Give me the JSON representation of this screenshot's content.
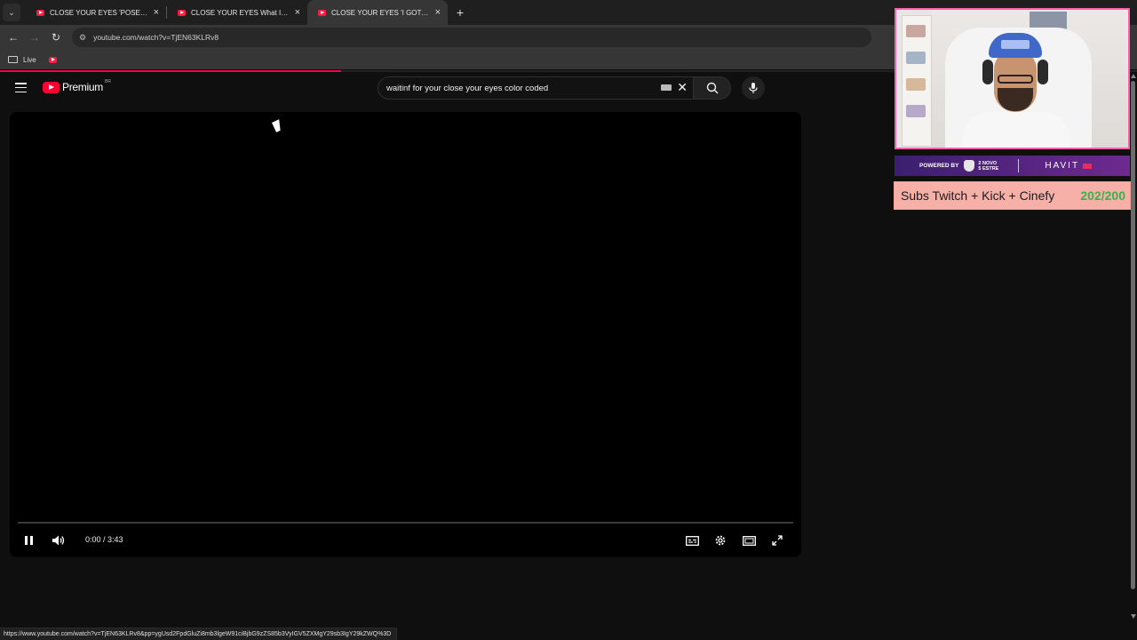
{
  "browser": {
    "tabs": [
      {
        "title": "CLOSE YOUR EYES 'POSE' MV -",
        "active": false
      },
      {
        "title": "CLOSE YOUR EYES What If I Mi",
        "active": false
      },
      {
        "title": "CLOSE YOUR EYES 'I GOT IT' (O",
        "active": true
      }
    ],
    "url": "youtube.com/watch?v=TjEN63KLRv8",
    "bookmarks": [
      {
        "label": "Live"
      }
    ],
    "status_url": "https://www.youtube.com/watch?v=TjEN63KLRv8&pp=ygUsd2FpdGluZi8mb3lgeW91ciBjbG9zZS85b3VyIGV5ZXMgY29sb3IgY29kZWQ%3D",
    "load_progress": 0.3
  },
  "youtube": {
    "logo_text": "Premium",
    "country_code": "BR",
    "search_value": "waitinf for your close your eyes color coded",
    "icons": {
      "menu": "hamburger-icon",
      "search": "search-icon",
      "mic": "microphone-icon",
      "clear": "close-icon",
      "keyboard": "keyboard-icon"
    }
  },
  "player": {
    "time": "0:00 / 3:43",
    "progress": 0,
    "state": "playing",
    "controls": [
      "pause-icon",
      "volume-icon",
      "subtitles-icon",
      "settings-icon",
      "theater-icon",
      "fullscreen-icon"
    ]
  },
  "overlay": {
    "sponsor_powered": "POWERED BY",
    "sponsor_brand1": "2 NOVO\n5 ESTRE",
    "sponsor_brand2": "HAVIT",
    "subs_label": "Subs Twitch + Kick + Cinefy",
    "subs_count": "202/200",
    "colors": {
      "webcam_border": "#ff5fa8",
      "subs_bg": "#f7b0a8",
      "subs_count": "#37b24d",
      "accent": "#ff0033"
    }
  }
}
